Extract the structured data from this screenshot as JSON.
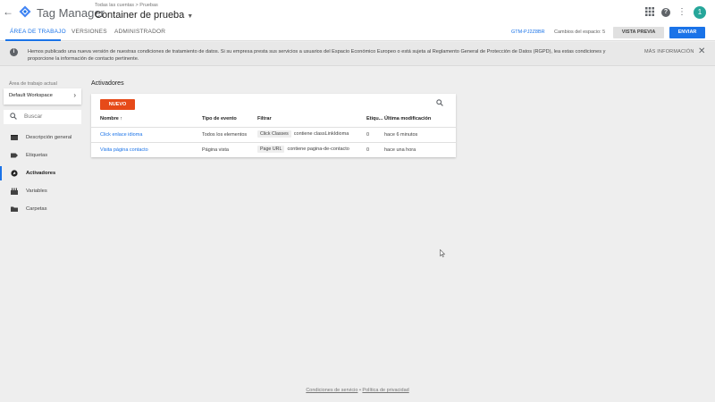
{
  "header": {
    "app_title": "Tag Manager",
    "breadcrumb": "Todas las cuentas > Pruebas",
    "container_name": "Container de prueba"
  },
  "tabs": [
    {
      "label": "ÁREA DE TRABAJO",
      "active": true
    },
    {
      "label": "VERSIONES",
      "active": false
    },
    {
      "label": "ADMINISTRADOR",
      "active": false
    }
  ],
  "toolbar": {
    "container_id": "GTM-PJ2Z8BR",
    "changes_label": "Cambios del espacio: 5",
    "preview_label": "VISTA PREVIA",
    "submit_label": "ENVIAR"
  },
  "user": {
    "avatar_letter": "1",
    "avatar_color": "#26a69a"
  },
  "banner": {
    "text": "Hemos publicado una nueva versión de nuestras condiciones de tratamiento de datos. Si su empresa presta sus servicios a usuarios del Espacio Económico Europeo o está sujeta al Reglamento General de Protección de Datos (RGPD), lea estas condiciones y proporcione la información de contacto pertinente.",
    "more_label": "MÁS INFORMACIÓN"
  },
  "sidebar": {
    "workspace_label": "Área de trabajo actual",
    "workspace_name": "Default Workspace",
    "search_placeholder": "Buscar",
    "items": [
      {
        "label": "Descripción general",
        "icon": "overview-icon",
        "active": false
      },
      {
        "label": "Etiquetas",
        "icon": "tag-icon",
        "active": false
      },
      {
        "label": "Activadores",
        "icon": "trigger-icon",
        "active": true
      },
      {
        "label": "Variables",
        "icon": "variables-icon",
        "active": false
      },
      {
        "label": "Carpetas",
        "icon": "folder-icon",
        "active": false
      }
    ]
  },
  "main": {
    "title": "Activadores",
    "new_label": "NUEVO",
    "columns": [
      "Nombre ↑",
      "Tipo de evento",
      "Filtrar",
      "Etiqu...",
      "Última modificación"
    ],
    "rows": [
      {
        "name": "Click enlace idioma",
        "event": "Todos los elementos",
        "filter_chip": "Click Classes",
        "filter_text": "contiene classLinkIdioma",
        "tags": "0",
        "modified": "hace 6 minutos"
      },
      {
        "name": "Visita página contacto",
        "event": "Página vista",
        "filter_chip": "Page URL",
        "filter_text": "contiene pagina-de-contacto",
        "tags": "0",
        "modified": "hace una hora"
      }
    ]
  },
  "footer": {
    "terms": "Condiciones de servicio",
    "separator": "•",
    "privacy": "Política de privacidad"
  },
  "colors": {
    "accent": "#1a73e8",
    "new_button": "#e64a19"
  }
}
